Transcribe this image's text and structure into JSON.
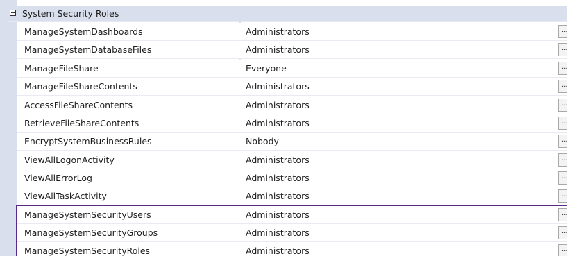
{
  "category": {
    "label": "System Security Roles",
    "expanded": true
  },
  "ellipsis_label": "...",
  "properties": [
    {
      "name": "ManageSystemDashboards",
      "value": "Administrators"
    },
    {
      "name": "ManageSystemDatabaseFiles",
      "value": "Administrators"
    },
    {
      "name": "ManageFileShare",
      "value": "Everyone"
    },
    {
      "name": "ManageFileShareContents",
      "value": "Administrators"
    },
    {
      "name": "AccessFileShareContents",
      "value": "Administrators"
    },
    {
      "name": "RetrieveFileShareContents",
      "value": "Administrators"
    },
    {
      "name": "EncryptSystemBusinessRules",
      "value": "Nobody"
    },
    {
      "name": "ViewAllLogonActivity",
      "value": "Administrators"
    },
    {
      "name": "ViewAllErrorLog",
      "value": "Administrators"
    },
    {
      "name": "ViewAllTaskActivity",
      "value": "Administrators"
    },
    {
      "name": "ManageSystemSecurityUsers",
      "value": "Administrators"
    },
    {
      "name": "ManageSystemSecurityGroups",
      "value": "Administrators"
    },
    {
      "name": "ManageSystemSecurityRoles",
      "value": "Administrators"
    }
  ],
  "colors": {
    "margin": "#d9dfec",
    "highlight_border": "#5a2a86"
  }
}
